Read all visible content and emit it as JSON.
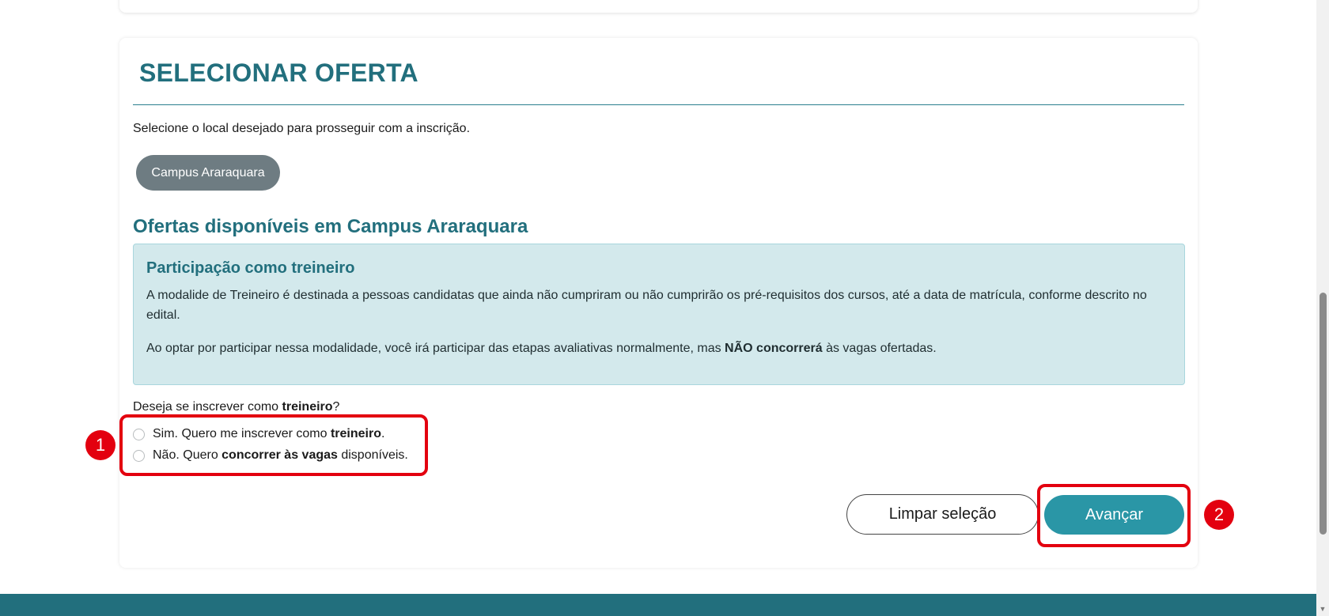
{
  "section": {
    "title": "SELECIONAR OFERTA",
    "instruction": "Selecione o local desejado para prosseguir com a inscrição."
  },
  "campus_button": {
    "label": "Campus Araraquara"
  },
  "offers": {
    "title": "Ofertas disponíveis em Campus Araraquara"
  },
  "info_box": {
    "title": "Participação como treineiro",
    "paragraph1": "A modalide de Treineiro é destinada a pessoas candidatas que ainda não cumpriram ou não cumprirão os pré-requisitos dos cursos, até a data de matrícula, conforme descrito no edital.",
    "paragraph2_before": "Ao optar por participar nessa modalidade, você irá participar das etapas avaliativas normalmente, mas ",
    "paragraph2_bold": "NÃO concorrerá",
    "paragraph2_after": " às vagas ofertadas."
  },
  "question": {
    "before": "Deseja se inscrever como ",
    "bold": "treineiro",
    "after": "?"
  },
  "options": {
    "yes": {
      "before": "Sim. Quero me inscrever como ",
      "bold": "treineiro",
      "after": "."
    },
    "no": {
      "before": "Não. Quero ",
      "bold": "concorrer às vagas",
      "after": " disponíveis."
    }
  },
  "buttons": {
    "clear": "Limpar seleção",
    "next": "Avançar"
  },
  "annotations": {
    "badge1": "1",
    "badge2": "2",
    "color": "#e3000f"
  },
  "colors": {
    "accent": "#226f7d",
    "button_primary": "#2a96a6",
    "campus_pill": "#6e7c82",
    "info_bg": "#d3e9ec"
  }
}
